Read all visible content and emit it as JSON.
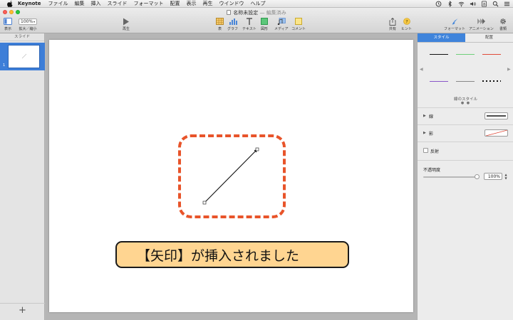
{
  "menubar": {
    "app_name": "Keynote",
    "items": [
      "ファイル",
      "編集",
      "挿入",
      "スライド",
      "フォーマット",
      "配置",
      "表示",
      "再生",
      "ウインドウ",
      "ヘルプ"
    ]
  },
  "window": {
    "title": "名称未設定",
    "status": "— 編集済み"
  },
  "toolbar": {
    "view_label": "表示",
    "zoom_value": "100%",
    "zoom_label": "拡大／縮小",
    "play_label": "再生",
    "table_label": "表",
    "chart_label": "グラフ",
    "text_label": "テキスト",
    "shape_label": "図形",
    "media_label": "メディア",
    "comment_label": "コメント",
    "share_label": "共有",
    "tips_label": "ヒント",
    "format_label": "フォーマット",
    "animate_label": "アニメーション",
    "document_label": "書類"
  },
  "slides_panel": {
    "header": "スライド",
    "slide_number": "1",
    "add_button": "+"
  },
  "canvas": {
    "callout_text": "【矢印】が挿入されました",
    "highlight_color": "#e8542a",
    "callout_color": "#ffd591"
  },
  "inspector": {
    "tab_style": "スタイル",
    "tab_arrange": "配置",
    "line_styles_label": "線のスタイル",
    "line_styles_dots": "● ●",
    "line_section": "線",
    "shadow_section": "影",
    "reflection_label": "反射",
    "opacity_label": "不透明度",
    "opacity_value": "100%",
    "opacity_fraction": 1.0,
    "accent_color": "#3f84db"
  }
}
